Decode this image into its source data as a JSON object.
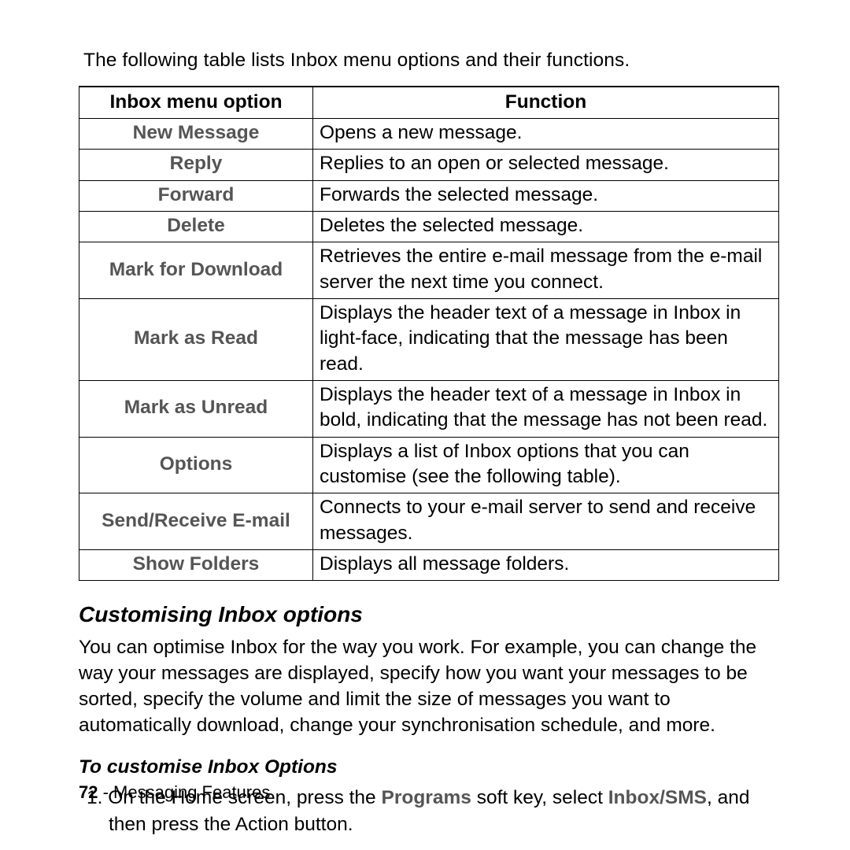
{
  "intro": "The following table lists Inbox menu options and their functions.",
  "table": {
    "headers": {
      "option": "Inbox menu option",
      "function": "Function"
    },
    "rows": [
      {
        "option": "New Message",
        "function": "Opens a new message."
      },
      {
        "option": "Reply",
        "function": "Replies to an open or selected message."
      },
      {
        "option": "Forward",
        "function": "Forwards the selected message."
      },
      {
        "option": "Delete",
        "function": "Deletes the selected message."
      },
      {
        "option": "Mark for Download",
        "function": "Retrieves the entire e-mail message from the e-mail server the next time you connect."
      },
      {
        "option": "Mark as Read",
        "function": "Displays the header text of a message in Inbox in light-face, indicating that the message has been read."
      },
      {
        "option": "Mark as Unread",
        "function": "Displays the header text of a message in Inbox in bold, indicating that the message has not been read."
      },
      {
        "option": "Options",
        "function": "Displays a list of Inbox options that you can customise (see the following table)."
      },
      {
        "option": "Send/Receive E-mail",
        "function": "Connects to your e-mail server to send and receive messages."
      },
      {
        "option": "Show Folders",
        "function": "Displays all message folders."
      }
    ]
  },
  "section": {
    "heading": "Customising Inbox options",
    "body": "You can optimise Inbox for the way you work. For example, you can change the way your messages are displayed, specify how you want your messages to be sorted, specify the volume and limit the size of messages you want to automatically download, change your synchronisation schedule, and more.",
    "subheading": "To customise Inbox Options",
    "step1_pre": "1. On the Home screen, press the ",
    "step1_programs": "Programs",
    "step1_mid": " soft key, select ",
    "step1_inbox": "Inbox/SMS",
    "step1_post": ", and then press the Action button."
  },
  "footer": {
    "page": "72",
    "section": " - Messaging Features"
  }
}
